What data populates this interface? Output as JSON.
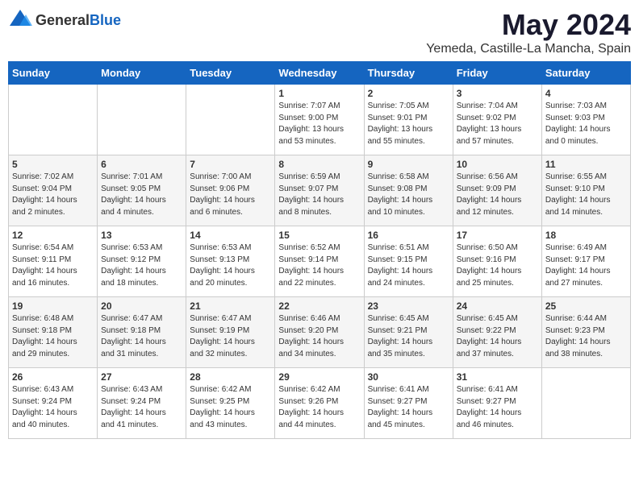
{
  "header": {
    "logo_general": "General",
    "logo_blue": "Blue",
    "month_title": "May 2024",
    "location": "Yemeda, Castille-La Mancha, Spain"
  },
  "weekdays": [
    "Sunday",
    "Monday",
    "Tuesday",
    "Wednesday",
    "Thursday",
    "Friday",
    "Saturday"
  ],
  "weeks": [
    [
      {
        "day": "",
        "info": ""
      },
      {
        "day": "",
        "info": ""
      },
      {
        "day": "",
        "info": ""
      },
      {
        "day": "1",
        "info": "Sunrise: 7:07 AM\nSunset: 9:00 PM\nDaylight: 13 hours\nand 53 minutes."
      },
      {
        "day": "2",
        "info": "Sunrise: 7:05 AM\nSunset: 9:01 PM\nDaylight: 13 hours\nand 55 minutes."
      },
      {
        "day": "3",
        "info": "Sunrise: 7:04 AM\nSunset: 9:02 PM\nDaylight: 13 hours\nand 57 minutes."
      },
      {
        "day": "4",
        "info": "Sunrise: 7:03 AM\nSunset: 9:03 PM\nDaylight: 14 hours\nand 0 minutes."
      }
    ],
    [
      {
        "day": "5",
        "info": "Sunrise: 7:02 AM\nSunset: 9:04 PM\nDaylight: 14 hours\nand 2 minutes."
      },
      {
        "day": "6",
        "info": "Sunrise: 7:01 AM\nSunset: 9:05 PM\nDaylight: 14 hours\nand 4 minutes."
      },
      {
        "day": "7",
        "info": "Sunrise: 7:00 AM\nSunset: 9:06 PM\nDaylight: 14 hours\nand 6 minutes."
      },
      {
        "day": "8",
        "info": "Sunrise: 6:59 AM\nSunset: 9:07 PM\nDaylight: 14 hours\nand 8 minutes."
      },
      {
        "day": "9",
        "info": "Sunrise: 6:58 AM\nSunset: 9:08 PM\nDaylight: 14 hours\nand 10 minutes."
      },
      {
        "day": "10",
        "info": "Sunrise: 6:56 AM\nSunset: 9:09 PM\nDaylight: 14 hours\nand 12 minutes."
      },
      {
        "day": "11",
        "info": "Sunrise: 6:55 AM\nSunset: 9:10 PM\nDaylight: 14 hours\nand 14 minutes."
      }
    ],
    [
      {
        "day": "12",
        "info": "Sunrise: 6:54 AM\nSunset: 9:11 PM\nDaylight: 14 hours\nand 16 minutes."
      },
      {
        "day": "13",
        "info": "Sunrise: 6:53 AM\nSunset: 9:12 PM\nDaylight: 14 hours\nand 18 minutes."
      },
      {
        "day": "14",
        "info": "Sunrise: 6:53 AM\nSunset: 9:13 PM\nDaylight: 14 hours\nand 20 minutes."
      },
      {
        "day": "15",
        "info": "Sunrise: 6:52 AM\nSunset: 9:14 PM\nDaylight: 14 hours\nand 22 minutes."
      },
      {
        "day": "16",
        "info": "Sunrise: 6:51 AM\nSunset: 9:15 PM\nDaylight: 14 hours\nand 24 minutes."
      },
      {
        "day": "17",
        "info": "Sunrise: 6:50 AM\nSunset: 9:16 PM\nDaylight: 14 hours\nand 25 minutes."
      },
      {
        "day": "18",
        "info": "Sunrise: 6:49 AM\nSunset: 9:17 PM\nDaylight: 14 hours\nand 27 minutes."
      }
    ],
    [
      {
        "day": "19",
        "info": "Sunrise: 6:48 AM\nSunset: 9:18 PM\nDaylight: 14 hours\nand 29 minutes."
      },
      {
        "day": "20",
        "info": "Sunrise: 6:47 AM\nSunset: 9:18 PM\nDaylight: 14 hours\nand 31 minutes."
      },
      {
        "day": "21",
        "info": "Sunrise: 6:47 AM\nSunset: 9:19 PM\nDaylight: 14 hours\nand 32 minutes."
      },
      {
        "day": "22",
        "info": "Sunrise: 6:46 AM\nSunset: 9:20 PM\nDaylight: 14 hours\nand 34 minutes."
      },
      {
        "day": "23",
        "info": "Sunrise: 6:45 AM\nSunset: 9:21 PM\nDaylight: 14 hours\nand 35 minutes."
      },
      {
        "day": "24",
        "info": "Sunrise: 6:45 AM\nSunset: 9:22 PM\nDaylight: 14 hours\nand 37 minutes."
      },
      {
        "day": "25",
        "info": "Sunrise: 6:44 AM\nSunset: 9:23 PM\nDaylight: 14 hours\nand 38 minutes."
      }
    ],
    [
      {
        "day": "26",
        "info": "Sunrise: 6:43 AM\nSunset: 9:24 PM\nDaylight: 14 hours\nand 40 minutes."
      },
      {
        "day": "27",
        "info": "Sunrise: 6:43 AM\nSunset: 9:24 PM\nDaylight: 14 hours\nand 41 minutes."
      },
      {
        "day": "28",
        "info": "Sunrise: 6:42 AM\nSunset: 9:25 PM\nDaylight: 14 hours\nand 43 minutes."
      },
      {
        "day": "29",
        "info": "Sunrise: 6:42 AM\nSunset: 9:26 PM\nDaylight: 14 hours\nand 44 minutes."
      },
      {
        "day": "30",
        "info": "Sunrise: 6:41 AM\nSunset: 9:27 PM\nDaylight: 14 hours\nand 45 minutes."
      },
      {
        "day": "31",
        "info": "Sunrise: 6:41 AM\nSunset: 9:27 PM\nDaylight: 14 hours\nand 46 minutes."
      },
      {
        "day": "",
        "info": ""
      }
    ]
  ]
}
